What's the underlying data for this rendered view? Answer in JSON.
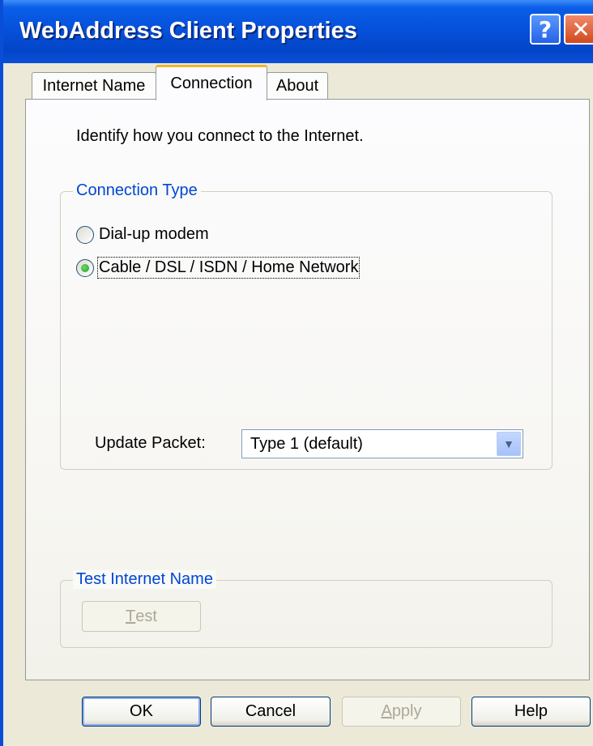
{
  "window": {
    "title": "WebAddress Client Properties",
    "help_button": "?",
    "close_button": "✕"
  },
  "tabs": [
    {
      "label": "Internet Name",
      "selected": false
    },
    {
      "label": "Connection",
      "selected": true
    },
    {
      "label": "About",
      "selected": false
    }
  ],
  "connection": {
    "intro": "Identify how you connect to the Internet.",
    "group_label": "Connection Type",
    "options": [
      {
        "label": "Dial-up modem",
        "checked": false
      },
      {
        "label": "Cable / DSL / ISDN / Home Network",
        "checked": true
      }
    ],
    "update_packet_label": "Update Packet:",
    "update_packet_value": "Type 1 (default)"
  },
  "test": {
    "group_label": "Test Internet Name",
    "button_mnemonic": "T",
    "button_rest": "est",
    "enabled": false
  },
  "buttons": {
    "ok": "OK",
    "cancel": "Cancel",
    "apply_mnemonic": "A",
    "apply_rest": "pply",
    "apply_enabled": false,
    "help": "Help"
  }
}
